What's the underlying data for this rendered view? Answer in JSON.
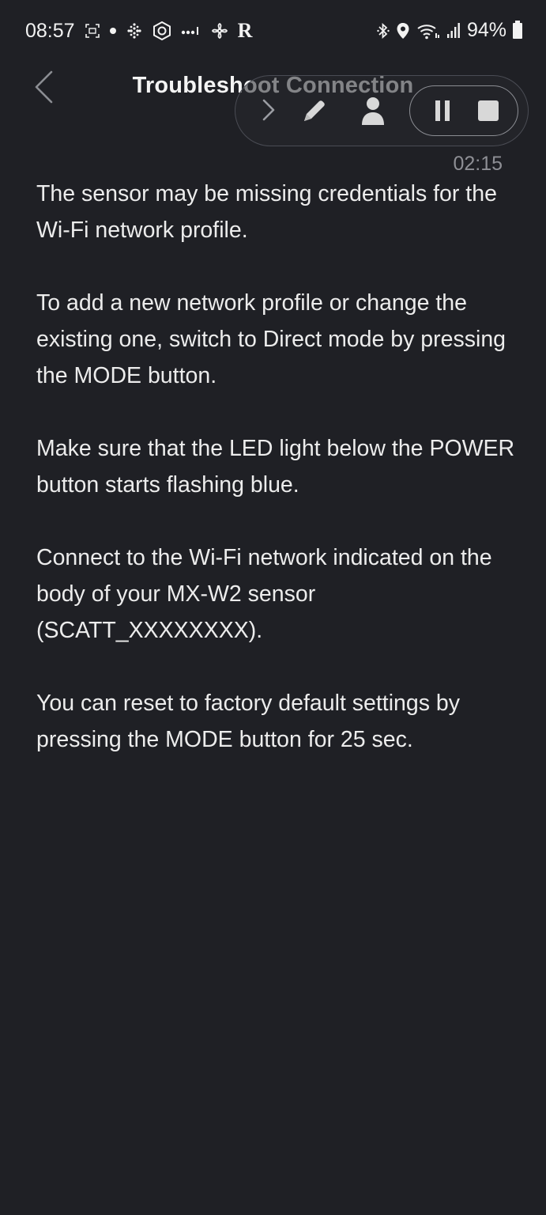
{
  "status_bar": {
    "time": "08:57",
    "battery": "94%",
    "left_icons": [
      "screenshot-icon",
      "dot-icon",
      "grid-dots-icon",
      "hex-app-icon",
      "more-dots-icon",
      "fan-icon",
      "r-app-icon"
    ],
    "r_app_label": "R",
    "right_icons": [
      "bluetooth-icon",
      "location-icon",
      "wifi-icon",
      "signal-icon",
      "battery-icon"
    ]
  },
  "header": {
    "title": "Troubleshoot Connection",
    "back_icon": "chevron-left-icon"
  },
  "recorder": {
    "timer": "02:15",
    "icons": [
      "chevron-right-icon",
      "pen-icon",
      "person-icon",
      "pause-icon",
      "stop-icon"
    ]
  },
  "content": {
    "paragraphs": [
      "The sensor may be missing credentials for the Wi-Fi network profile.",
      "To add a new network profile or change the existing one, switch to Direct mode by pressing the MODE button.",
      "Make sure that the LED light below the POWER button starts flashing blue.",
      "Connect to the Wi-Fi network indicated on the body of your MX-W2 sensor (SCATT_XXXXXXXX).",
      "You can reset to factory default settings by pressing the MODE button for 25 sec."
    ]
  },
  "colors": {
    "background": "#1f2025",
    "text": "#ececec",
    "muted": "#8e8f95"
  }
}
